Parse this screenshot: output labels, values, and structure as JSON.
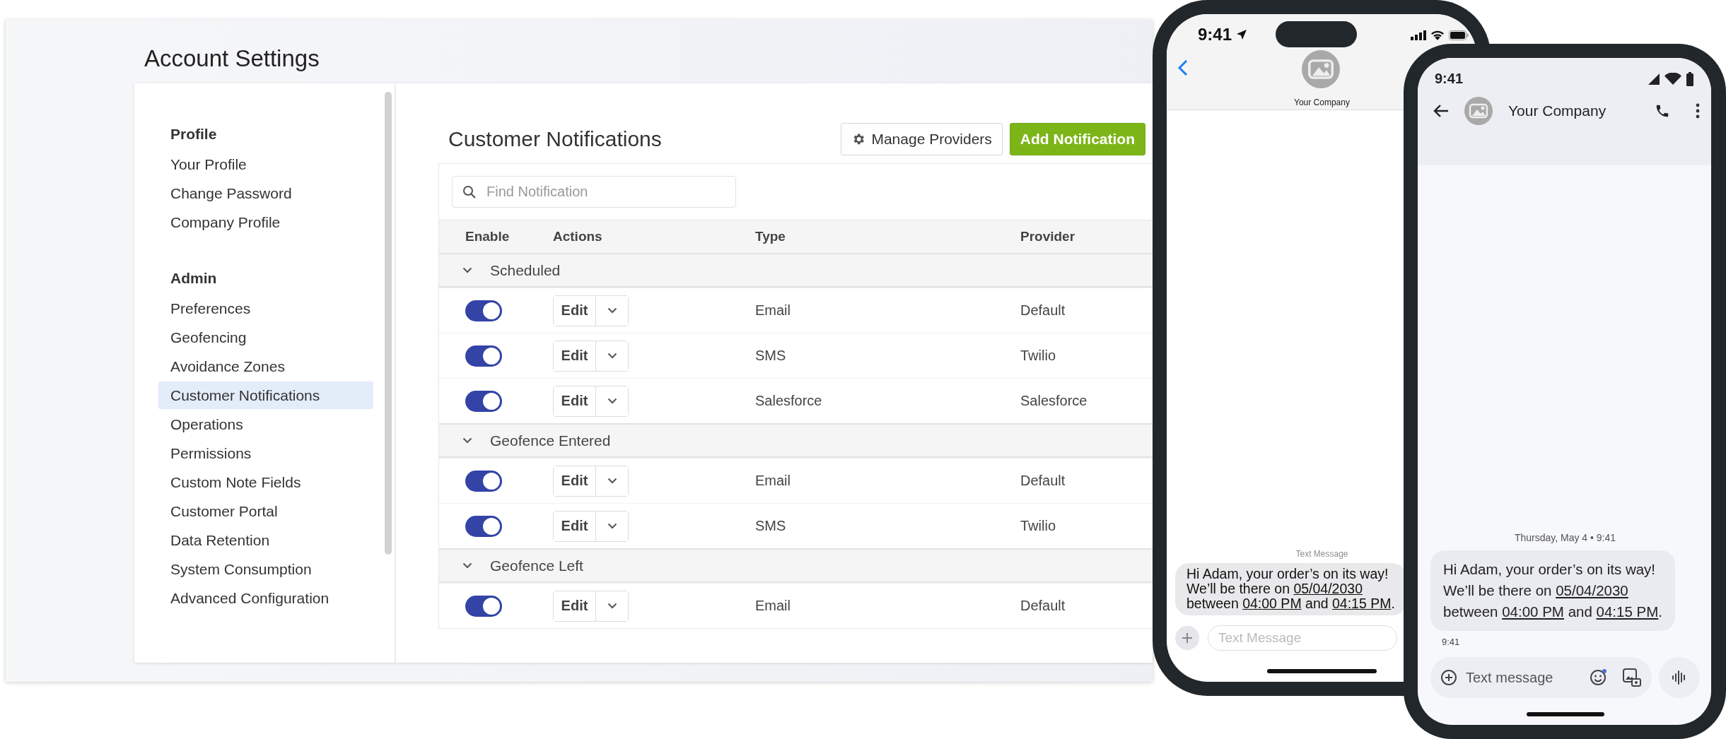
{
  "page": {
    "title": "Account Settings"
  },
  "sidebar": {
    "sections": [
      {
        "heading": "Profile",
        "items": [
          {
            "label": "Your Profile",
            "selected": false
          },
          {
            "label": "Change Password",
            "selected": false
          },
          {
            "label": "Company Profile",
            "selected": false
          }
        ]
      },
      {
        "heading": "Admin",
        "items": [
          {
            "label": "Preferences",
            "selected": false
          },
          {
            "label": "Geofencing",
            "selected": false
          },
          {
            "label": "Avoidance Zones",
            "selected": false
          },
          {
            "label": "Customer Notifications",
            "selected": true
          },
          {
            "label": "Operations",
            "selected": false
          },
          {
            "label": "Permissions",
            "selected": false
          },
          {
            "label": "Custom Note Fields",
            "selected": false
          },
          {
            "label": "Customer Portal",
            "selected": false
          },
          {
            "label": "Data Retention",
            "selected": false
          },
          {
            "label": "System Consumption",
            "selected": false
          },
          {
            "label": "Advanced Configuration",
            "selected": false
          }
        ]
      }
    ]
  },
  "notifications": {
    "title": "Customer Notifications",
    "buttons": [
      {
        "label": "Manage Providers",
        "kind": "secondary"
      },
      {
        "label": "Add Notification",
        "kind": "primary"
      }
    ],
    "search": {
      "placeholder": "Find Notification"
    },
    "columns": [
      "Enable",
      "Actions",
      "Type",
      "Provider"
    ],
    "groups": [
      {
        "name": "Scheduled",
        "expanded": true,
        "rows": [
          {
            "enabled": true,
            "action": "Edit",
            "type": "Email",
            "provider": "Default"
          },
          {
            "enabled": true,
            "action": "Edit",
            "type": "SMS",
            "provider": "Twilio"
          },
          {
            "enabled": true,
            "action": "Edit",
            "type": "Salesforce",
            "provider": "Salesforce"
          }
        ]
      },
      {
        "name": "Geofence Entered",
        "expanded": true,
        "rows": [
          {
            "enabled": true,
            "action": "Edit",
            "type": "Email",
            "provider": "Default"
          },
          {
            "enabled": true,
            "action": "Edit",
            "type": "SMS",
            "provider": "Twilio"
          }
        ]
      },
      {
        "name": "Geofence Left",
        "expanded": true,
        "rows": [
          {
            "enabled": true,
            "action": "Edit",
            "type": "Email",
            "provider": "Default"
          }
        ]
      }
    ]
  },
  "iphone": {
    "time": "9:41",
    "contact": "Your Company",
    "label": "Text Message",
    "message": [
      [
        {
          "text": "Hi Adam, your order’s on its way!",
          "underlined": false
        }
      ],
      [
        {
          "text": "We’ll be there on ",
          "underlined": false
        },
        {
          "text": "05/04/2030",
          "underlined": true
        }
      ],
      [
        {
          "text": "between ",
          "underlined": false
        },
        {
          "text": "04:00 PM",
          "underlined": true
        },
        {
          "text": " and ",
          "underlined": false
        },
        {
          "text": "04:15 PM",
          "underlined": true
        },
        {
          "text": ".",
          "underlined": false
        }
      ]
    ],
    "input": {
      "placeholder": "Text Message"
    }
  },
  "android": {
    "time": "9:41",
    "contact": "Your Company",
    "date": "Thursday, May 4 • 9:41",
    "message": [
      [
        {
          "text": "Hi Adam, your order’s on its way!",
          "underlined": false
        }
      ],
      [
        {
          "text": "We’ll be there on ",
          "underlined": false
        },
        {
          "text": "05/04/2030",
          "underlined": true
        }
      ],
      [
        {
          "text": "between ",
          "underlined": false
        },
        {
          "text": "04:00 PM",
          "underlined": true
        },
        {
          "text": " and ",
          "underlined": false
        },
        {
          "text": "04:15 PM",
          "underlined": true
        },
        {
          "text": ".",
          "underlined": false
        }
      ]
    ],
    "timestamp": "9:41",
    "input": {
      "placeholder": "Text message"
    }
  }
}
